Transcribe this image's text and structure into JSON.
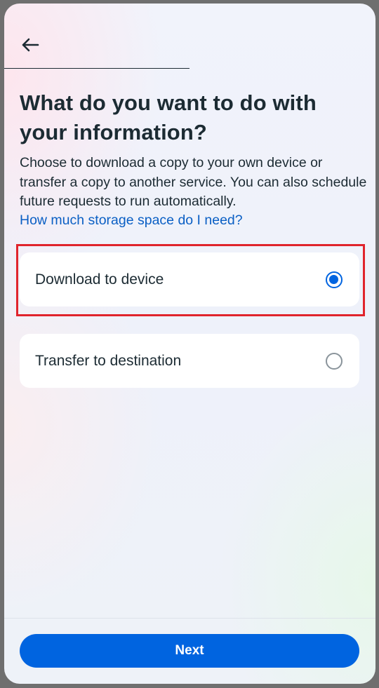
{
  "header": {
    "back_icon": "arrow-left-icon"
  },
  "main": {
    "title": "What do you want to do with your information?",
    "description": "Choose to download a copy to your own device or transfer a copy to another service. You can also schedule future requests to run automatically.",
    "help_link": "How much storage space do I need?",
    "options": [
      {
        "label": "Download to device",
        "selected": true
      },
      {
        "label": "Transfer to destination",
        "selected": false
      }
    ]
  },
  "footer": {
    "next_label": "Next"
  },
  "colors": {
    "accent": "#0064e0",
    "link": "#0a5fc4",
    "text": "#1c2b33",
    "highlight_box": "#e0242c"
  }
}
